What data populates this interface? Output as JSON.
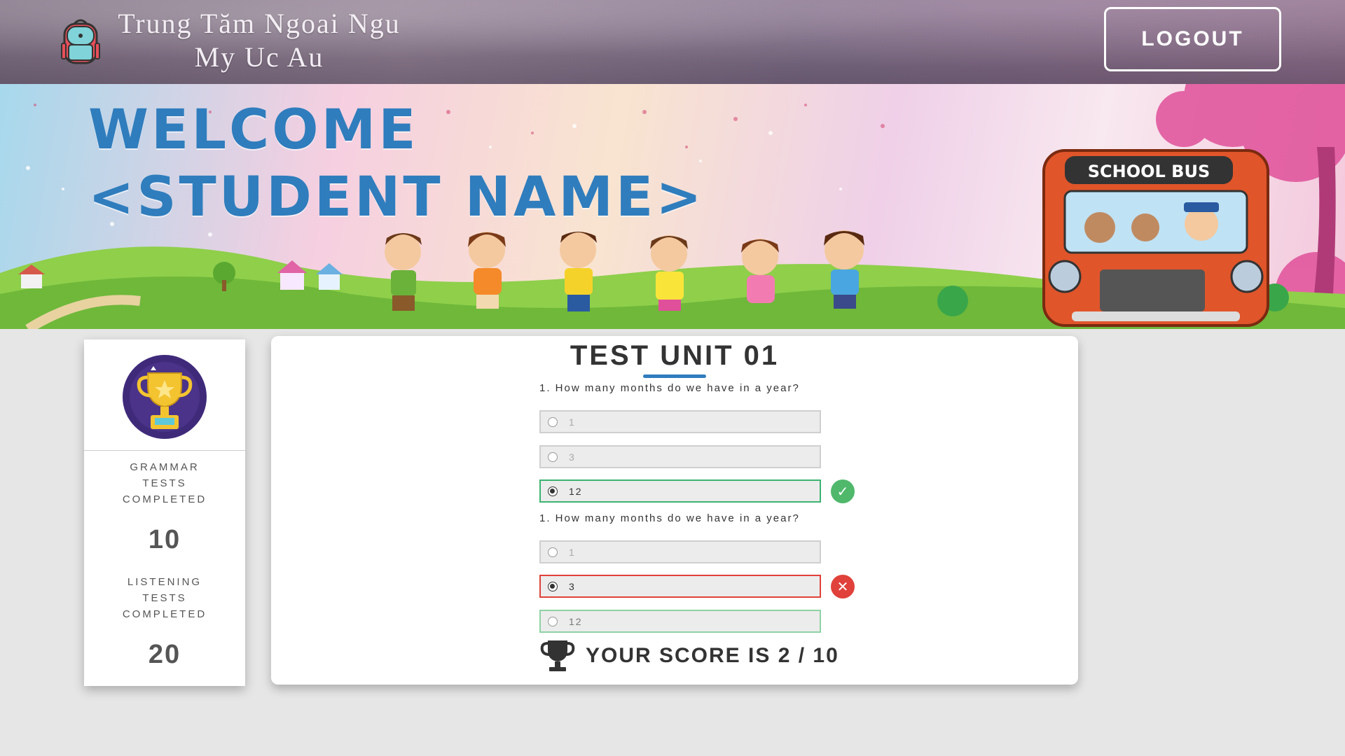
{
  "header": {
    "brand_line1": "Trung Tăm Ngoai Ngu",
    "brand_line2": "My Uc Au",
    "logout_label": "LOGOUT"
  },
  "banner": {
    "welcome_line1": "WELCOME",
    "welcome_line2": "<STUDENT NAME>",
    "bus_sign": "SCHOOL BUS"
  },
  "stats": {
    "grammar_label": [
      "GRAMMAR",
      "TESTS",
      "COMPLETED"
    ],
    "grammar_value": "10",
    "listening_label": [
      "LISTENING",
      "TESTS",
      "COMPLETED"
    ],
    "listening_value": "20"
  },
  "test": {
    "title": "TEST UNIT 01",
    "questions": [
      {
        "text": "1. How many months do we have in a year?",
        "options": [
          "1",
          "3",
          "12"
        ],
        "selected": 2,
        "result": "correct"
      },
      {
        "text": "1. How many months do we have in a year?",
        "options": [
          "1",
          "3",
          "12"
        ],
        "selected": 1,
        "result": "wrong"
      }
    ],
    "score_text": "YOUR SCORE IS 2 / 10"
  },
  "colors": {
    "accent_blue": "#2f7dbd",
    "correct_green": "#4fb86b",
    "wrong_red": "#e0413a",
    "trophy_bg": "#3f2a7a",
    "trophy_gold": "#f4c430"
  },
  "icons": {
    "logo": "backpack-icon",
    "stats": "trophy-icon",
    "correct": "check-icon",
    "wrong": "close-icon",
    "score": "trophy-icon"
  }
}
